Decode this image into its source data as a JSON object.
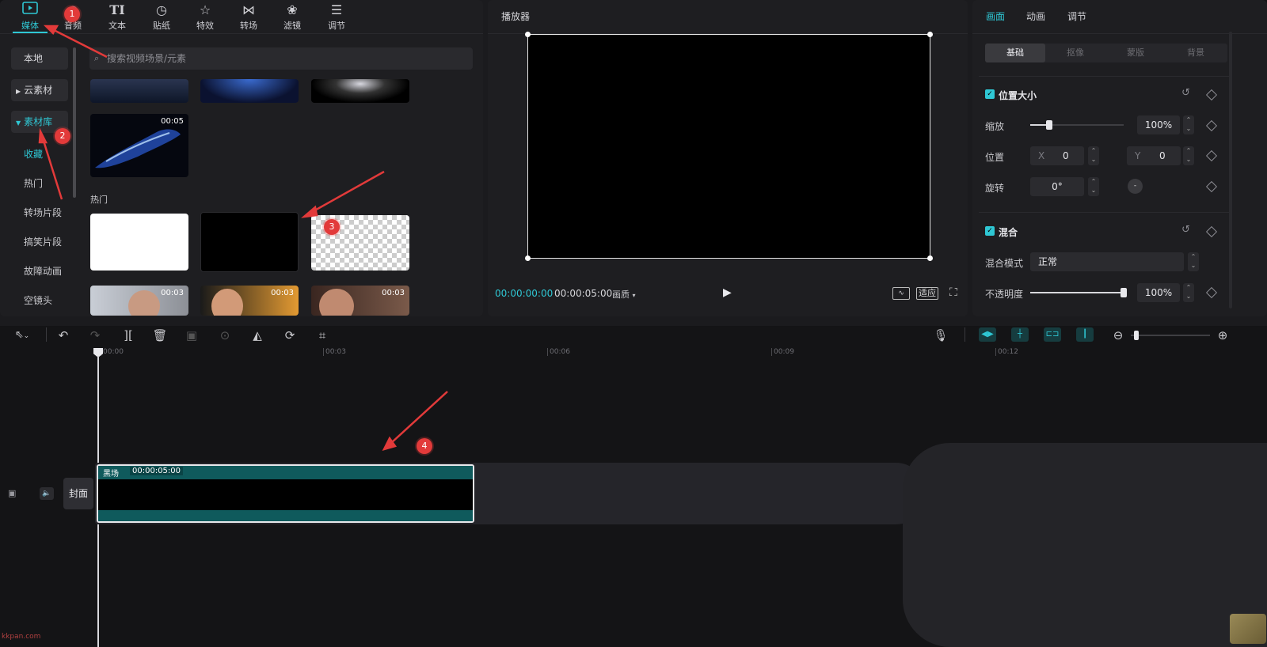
{
  "toolbar": {
    "tabs": [
      {
        "label": "媒体",
        "icon": "media-icon"
      },
      {
        "label": "音频",
        "icon": "audio-icon"
      },
      {
        "label": "文本",
        "icon": "text-icon"
      },
      {
        "label": "贴纸",
        "icon": "sticker-icon"
      },
      {
        "label": "特效",
        "icon": "effects-icon"
      },
      {
        "label": "转场",
        "icon": "transition-icon"
      },
      {
        "label": "滤镜",
        "icon": "filter-icon"
      },
      {
        "label": "调节",
        "icon": "adjust-icon"
      }
    ]
  },
  "media": {
    "sidebar": {
      "local": "本地",
      "cloud": "云素材",
      "library": "素材库",
      "items": [
        "收藏",
        "热门",
        "转场片段",
        "搞笑片段",
        "故障动画",
        "空镜头"
      ]
    },
    "search_placeholder": "搜索视频场景/元素",
    "section_hot": "热门",
    "durations": {
      "featured": "00:05",
      "face1": "00:03",
      "face2": "00:03",
      "face3": "00:03"
    }
  },
  "player": {
    "title": "播放器",
    "current_time": "00:00:00:00",
    "total_time": "00:00:05:00",
    "quality": "画质",
    "fit_label": "适应"
  },
  "props": {
    "tabs": [
      "画面",
      "动画",
      "调节"
    ],
    "subtabs": [
      "基础",
      "抠像",
      "蒙版",
      "背景"
    ],
    "position_size": {
      "title": "位置大小",
      "scale_label": "缩放",
      "scale_value": "100%",
      "scale_level": 0.2,
      "position_label": "位置",
      "x_label": "X",
      "x_value": "0",
      "y_label": "Y",
      "y_value": "0",
      "rotate_label": "旋转",
      "rotate_value": "0°"
    },
    "blend": {
      "title": "混合",
      "mode_label": "混合模式",
      "mode_value": "正常",
      "opacity_label": "不透明度",
      "opacity_value": "100%",
      "opacity_level": 1.0
    }
  },
  "timeline": {
    "ticks": [
      "00:00",
      "00:03",
      "00:06",
      "00:09",
      "00:12"
    ],
    "cover_label": "封面",
    "clip": {
      "name": "黑场",
      "duration": "00:00:05:00"
    }
  },
  "annotations": [
    "1",
    "2",
    "3",
    "4"
  ],
  "watermark": "kkpan.com",
  "colors": {
    "accent": "#2fc7d4",
    "clip": "#0f5a5c",
    "marker": "#e23a3a"
  }
}
